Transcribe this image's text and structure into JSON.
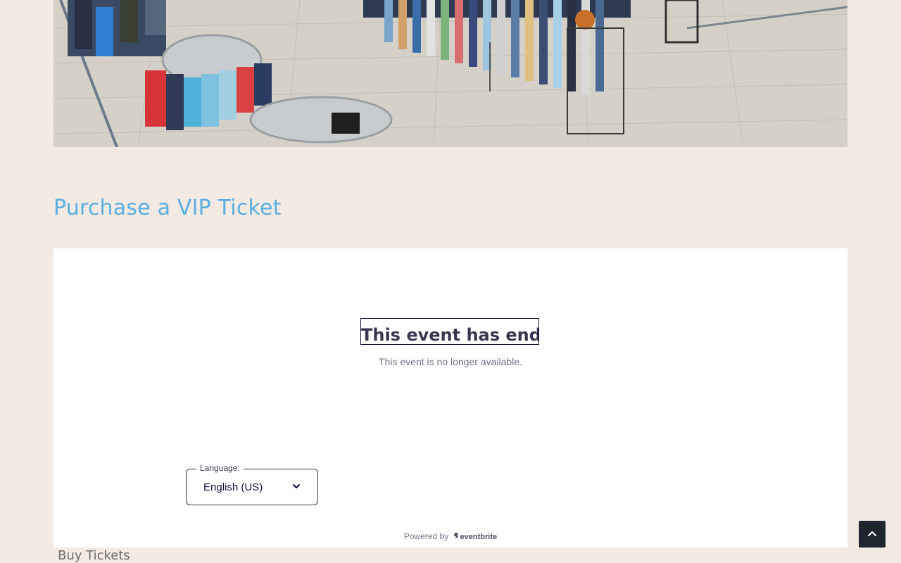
{
  "hero": {
    "image_name": "store-clothing-racks-image"
  },
  "section": {
    "title": "Purchase a VIP Ticket"
  },
  "widget": {
    "ended_title": "This event has ended",
    "ended_subtitle": "This event is no longer available.",
    "language": {
      "label": "Language:",
      "selected": "English (US)"
    },
    "powered_by_prefix": "Powered by",
    "powered_by_brand": "eventbrite"
  },
  "footer": {
    "buy_tickets": "Buy Tickets"
  },
  "icons": {
    "dropdown": "chevron-down-icon",
    "scroll_top": "chevron-up-icon",
    "brand": "eventbrite-logo-icon"
  },
  "colors": {
    "background": "#f3ebe3",
    "accent": "#5aaee0",
    "text_dark": "#39364f",
    "scroll_button": "#1f2630"
  }
}
